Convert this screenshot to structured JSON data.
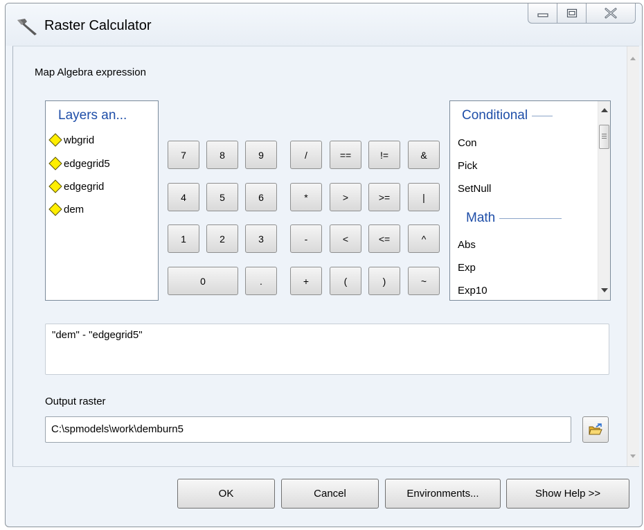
{
  "window": {
    "title": "Raster Calculator",
    "controls": [
      "minimize",
      "maximize",
      "close"
    ]
  },
  "main": {
    "expression_label": "Map Algebra expression",
    "layers_header": "Layers an...",
    "layers": [
      {
        "name": "wbgrid",
        "icon": "raster-layer-diamond-icon"
      },
      {
        "name": "edgegrid5",
        "icon": "raster-layer-diamond-icon"
      },
      {
        "name": "edgegrid",
        "icon": "raster-layer-diamond-icon"
      },
      {
        "name": "dem",
        "icon": "raster-layer-diamond-icon"
      }
    ],
    "keypad": {
      "row1": [
        "7",
        "8",
        "9",
        "/",
        "==",
        "!=",
        "&"
      ],
      "row2": [
        "4",
        "5",
        "6",
        "*",
        ">",
        ">=",
        "|"
      ],
      "row3": [
        "1",
        "2",
        "3",
        "-",
        "<",
        "<=",
        "^"
      ],
      "row4": [
        "0",
        ".",
        "+",
        "(",
        ")",
        "~"
      ]
    },
    "tools": {
      "categories": [
        {
          "name": "Conditional",
          "items": [
            "Con",
            "Pick",
            "SetNull"
          ]
        },
        {
          "name": "Math",
          "items": [
            "Abs",
            "Exp",
            "Exp10"
          ]
        }
      ]
    },
    "expression_text": "\"dem\" - \"edgegrid5\"",
    "output_label": "Output raster",
    "output_value": "C:\\spmodels\\work\\demburn5"
  },
  "footer": {
    "ok": "OK",
    "cancel": "Cancel",
    "environments": "Environments...",
    "help": "Show Help >>"
  },
  "colors": {
    "category_header": "#1e4ea8",
    "layer_icon_fill": "#ffee00",
    "dialog_background": "#eef3f9"
  }
}
